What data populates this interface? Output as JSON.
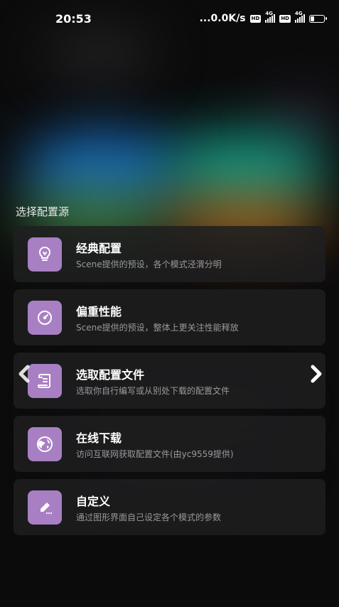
{
  "status_bar": {
    "time": "20:53",
    "network_speed": "...0.0K/s",
    "hd_label": "HD",
    "signal_label": "4G",
    "battery_level": 0.3
  },
  "section_title": "选择配置源",
  "options": [
    {
      "title": "经典配置",
      "description": "Scene提供的预设，各个模式泾渭分明",
      "icon": "lightbulb-icon"
    },
    {
      "title": "偏重性能",
      "description": "Scene提供的预设，整体上更关注性能释放",
      "icon": "speedometer-icon"
    },
    {
      "title": "选取配置文件",
      "description": "选取你自行编写或从别处下载的配置文件",
      "icon": "scroll-icon"
    },
    {
      "title": "在线下载",
      "description": "访问互联网获取配置文件(由yc9559提供)",
      "icon": "globe-icon"
    },
    {
      "title": "自定义",
      "description": "通过图形界面自己设定各个模式的参数",
      "icon": "pencil-icon"
    }
  ],
  "colors": {
    "accent": "#a87fc3",
    "card_background": "#1e1e20",
    "description_text": "#9a9a9e"
  }
}
